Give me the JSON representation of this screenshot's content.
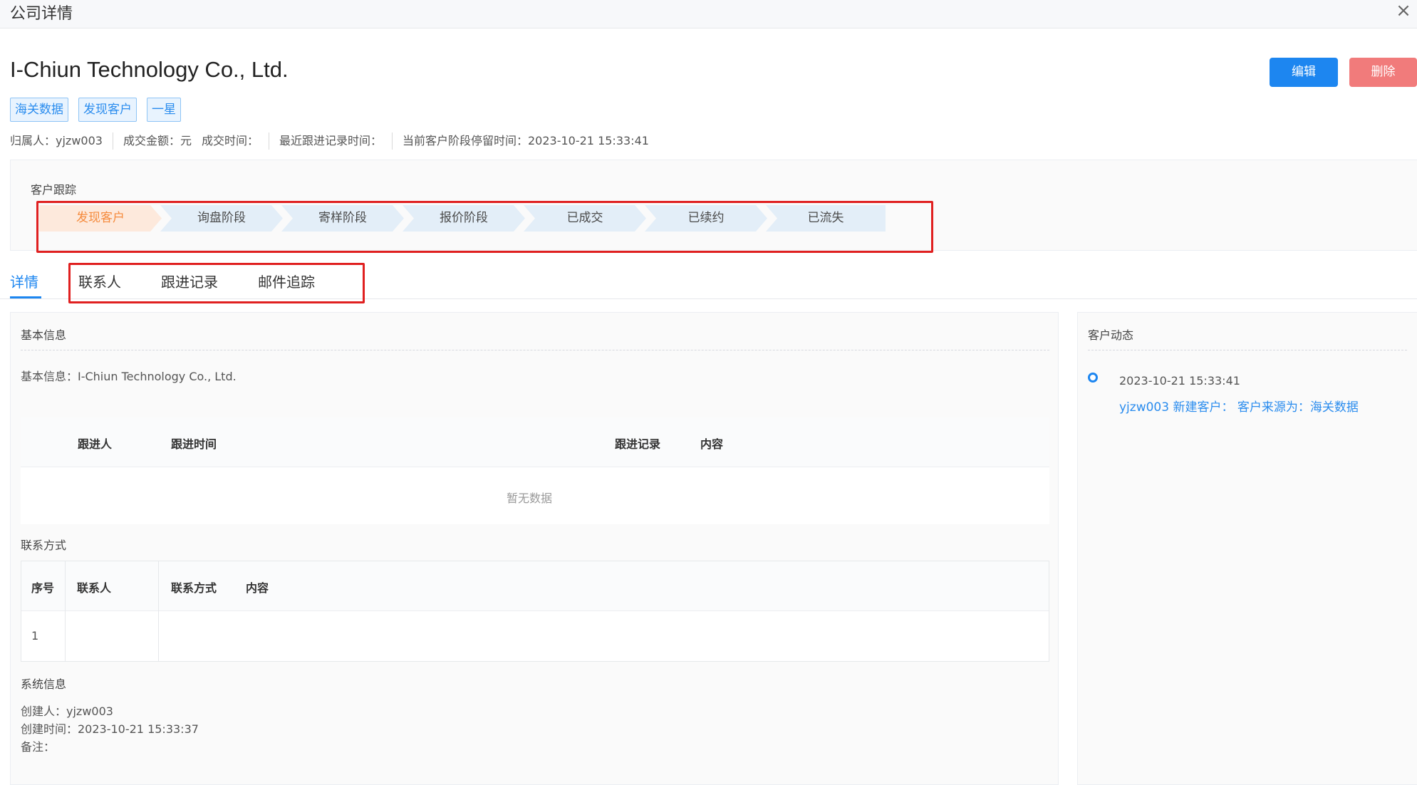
{
  "window": {
    "title": "公司详情",
    "close_glyph": "×"
  },
  "company": {
    "name": "I-Chiun Technology Co., Ltd.",
    "tags": [
      "海关数据",
      "发现客户",
      "一星"
    ]
  },
  "actions": {
    "edit_label": "编辑",
    "delete_label": "删除"
  },
  "meta": {
    "owner": "归属人：yjzw003",
    "deal_amount": "成交金额：元",
    "deal_time": "成交时间：",
    "last_follow_time": "最近跟进记录时间：",
    "stage_stay_time": "当前客户阶段停留时间：2023-10-21 15:33:41"
  },
  "tracking": {
    "label": "客户跟踪",
    "stages": [
      "发现客户",
      "询盘阶段",
      "寄样阶段",
      "报价阶段",
      "已成交",
      "已续约",
      "已流失"
    ],
    "active_index": 0
  },
  "tabs": [
    "详情",
    "联系人",
    "跟进记录",
    "邮件追踪"
  ],
  "basic": {
    "title": "基本信息",
    "line": "基本信息：I-Chiun Technology Co., Ltd.",
    "follow_table": {
      "headers": [
        "跟进人",
        "跟进时间",
        "跟进记录",
        "内容"
      ],
      "empty_text": "暂无数据"
    }
  },
  "contact": {
    "title": "联系方式",
    "headers": [
      "序号",
      "联系人",
      "联系方式",
      "内容"
    ],
    "rows": [
      [
        "1",
        "",
        "",
        ""
      ]
    ]
  },
  "system": {
    "title": "系统信息",
    "creator": "创建人：yjzw003",
    "created_at": "创建时间：2023-10-21 15:33:37",
    "remark": "备注："
  },
  "activity": {
    "title": "客户动态",
    "items": [
      {
        "time": "2023-10-21 15:33:41",
        "text": "yjzw003 新建客户：  客户来源为：海关数据"
      }
    ]
  },
  "colors": {
    "primary": "#1d86f0",
    "danger": "#f17b7b",
    "active_stage": "#f58a3c",
    "highlight": "#e02020"
  }
}
